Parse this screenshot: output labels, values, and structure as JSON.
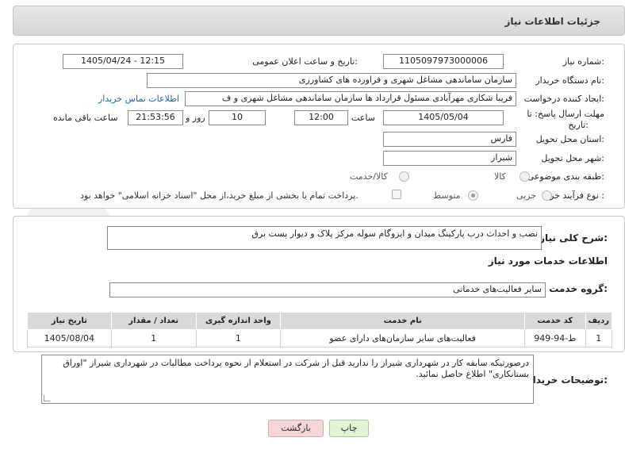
{
  "header": {
    "title": "جزئیات اطلاعات نیاز"
  },
  "form": {
    "need_number_label": "شماره نیاز:",
    "need_number": "1105097973000006",
    "announce_label": "تاریخ و ساعت اعلان عمومی:",
    "announce_value": "1405/04/24 - 12:15",
    "buyer_org_label": "نام دستگاه خریدار:",
    "buyer_org": "سازمان ساماندهی مشاغل شهری و فراورده های کشاورزی",
    "creator_label": "ایجاد کننده درخواست:",
    "creator": "فریبا شکاری مهرآبادی مسئول قرارداد ها سازمان ساماندهی مشاغل شهری و ف",
    "contact_link": "اطلاعات تماس خریدار",
    "deadline_label_1": "مهلت ارسال پاسخ: تا",
    "deadline_label_2": "تاریخ:",
    "deadline_date": "1405/05/04",
    "time_label": "ساعت",
    "deadline_time": "12:00",
    "days_value": "10",
    "days_label": "روز و",
    "remaining_time": "21:53:56",
    "remaining_label": "ساعت باقی مانده",
    "province_label": "استان محل تحویل:",
    "province": "فارس",
    "city_label": "شهر محل تحویل:",
    "city": "شیراز",
    "category_label": "طبقه بندی موضوعی:",
    "category_options": [
      "کالا",
      "کالا/خدمت"
    ],
    "purchase_type_label": "نوع فرآیند خرید :",
    "purchase_options": [
      "جزیی",
      "متوسط"
    ],
    "payment_note": "پرداخت تمام یا بخشی از مبلغ خرید،از محل \"اسناد خزانه اسلامی\" خواهد بود."
  },
  "summary": {
    "label": "شرح کلی نیاز:",
    "value": "نصب و احداث درب پارکینگ میدان و ایزوگام سوله مرکز پلاک و دیوار پست برق"
  },
  "services": {
    "section_title": "اطلاعات خدمات مورد نیاز",
    "group_label": "گروه خدمت:",
    "group_value": "سایر فعالیت‌های خدماتی",
    "columns": [
      "ردیف",
      "کد خدمت",
      "نام خدمت",
      "واحد اندازه گیری",
      "تعداد / مقدار",
      "تاریخ نیاز"
    ],
    "rows": [
      [
        "1",
        "ط-94-949",
        "فعالیت‌های سایر سازمان‌های دارای عضو",
        "1",
        "1",
        "1405/08/04"
      ]
    ]
  },
  "buyer_notes": {
    "label": "توضیحات خریدار:",
    "value": "درصورتیکه سابقه کار در شهرداری شیراز را ندارید قبل از شرکت در استعلام از نحوه پرداخت مطالبات در شهرداری شیراز \"اوراق بستانکاری\" اطلاع حاصل نمائید."
  },
  "buttons": {
    "back": "بازگشت",
    "print": "چاپ"
  },
  "watermark": {
    "text": "AriaTender.net"
  }
}
